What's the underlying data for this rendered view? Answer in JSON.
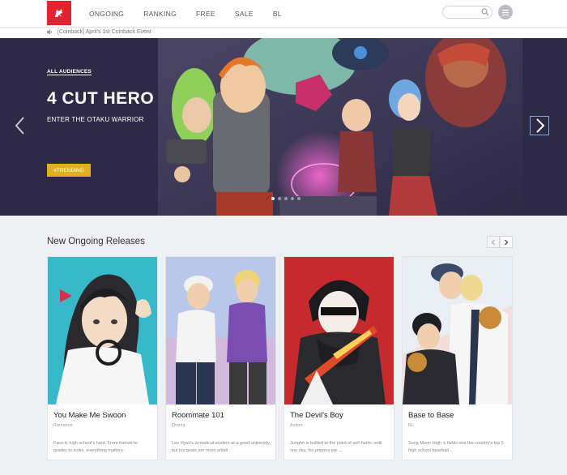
{
  "nav": {
    "items": [
      "ONGOING",
      "RANKING",
      "FREE",
      "SALE",
      "BL"
    ]
  },
  "search": {
    "placeholder": ""
  },
  "notice": {
    "text": "[Coinback] April's 1st Coinback Event"
  },
  "hero": {
    "badge": "ALL AUDIENCES",
    "title": "4 CUT HERO",
    "subtitle": "ENTER THE OTAKU WARRIOR",
    "tag": "#TRENDING"
  },
  "section": {
    "title": "New Ongoing Releases"
  },
  "cards": [
    {
      "title": "You Make Me Swoon",
      "genre": "Romance",
      "desc": "Face it, high school's hard. From friends to grades to looks, everything matters."
    },
    {
      "title": "Roommate 101",
      "genre": "Drama",
      "desc": "Lee Hyuk's a medical student at a good university, but his goals are more artisti"
    },
    {
      "title": "The Devil's Boy",
      "genre": "Action",
      "desc": "Jungho is bullied to the point of self-harm, until one day, his prayers are ..."
    },
    {
      "title": "Base to Base",
      "genre": "BL",
      "desc": "Sung Moon High is fields one the country's top 5 high school baseball ..."
    }
  ],
  "colors": {
    "brand": "#e0242f",
    "trending": "#e0b021",
    "hero_bg": "#2e2a45"
  }
}
